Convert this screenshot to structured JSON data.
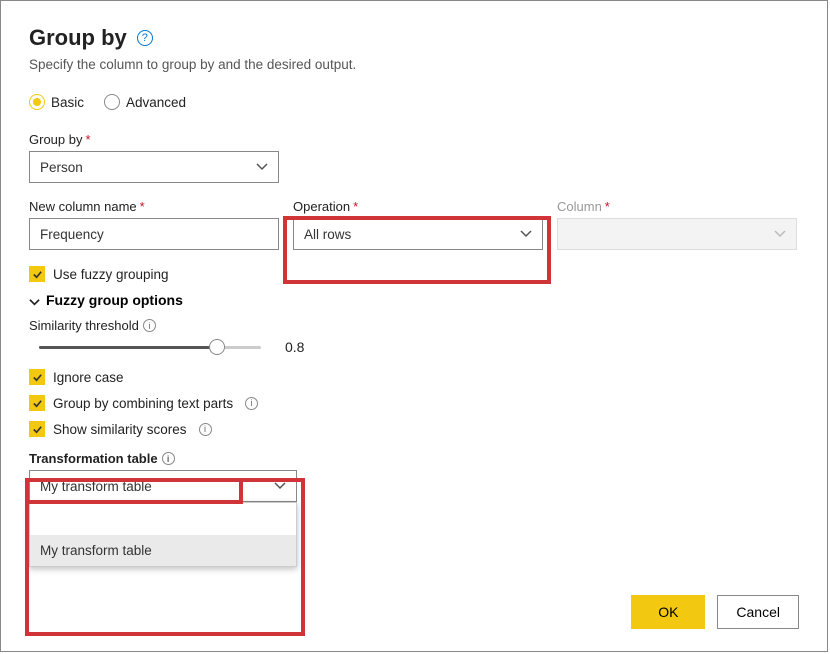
{
  "title": "Group by",
  "subtitle": "Specify the column to group by and the desired output.",
  "radios": {
    "basic": "Basic",
    "advanced": "Advanced"
  },
  "groupby": {
    "label": "Group by",
    "value": "Person"
  },
  "newcol": {
    "label": "New column name",
    "value": "Frequency"
  },
  "operation": {
    "label": "Operation",
    "value": "All rows"
  },
  "column": {
    "label": "Column",
    "value": ""
  },
  "fuzzy_check": "Use fuzzy grouping",
  "fuzzy_header": "Fuzzy group options",
  "similarity": {
    "label": "Similarity threshold",
    "value": "0.8"
  },
  "ignore_case": "Ignore case",
  "combine_text": "Group by combining text parts",
  "show_scores": "Show similarity scores",
  "transform": {
    "label": "Transformation table",
    "value": "My transform table",
    "option": "My transform table"
  },
  "buttons": {
    "ok": "OK",
    "cancel": "Cancel"
  }
}
